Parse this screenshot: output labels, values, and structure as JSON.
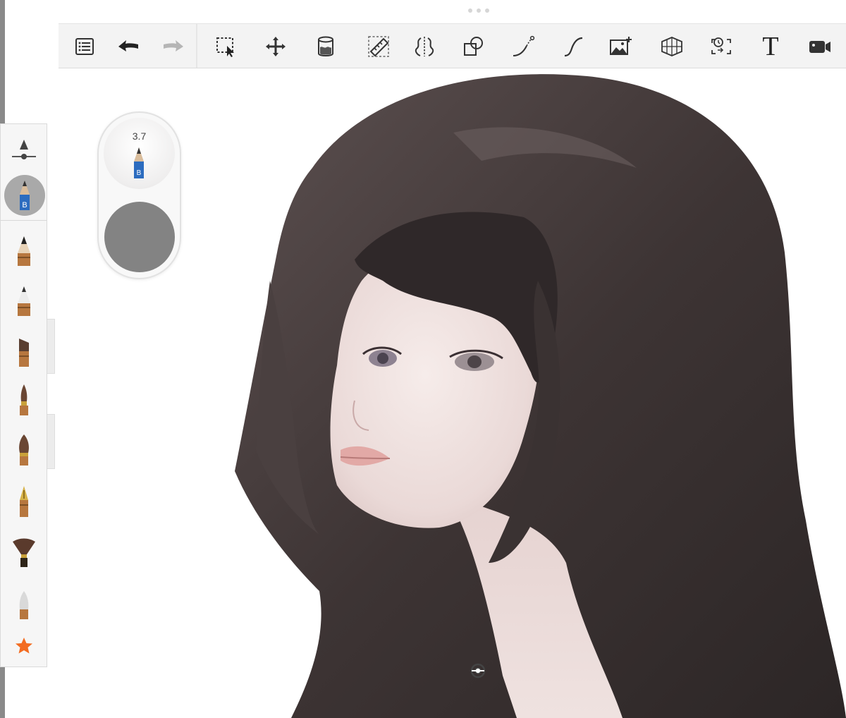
{
  "app": {
    "accent_color": "#f36c21",
    "current_color": "#838383"
  },
  "toolbar": {
    "items": [
      {
        "name": "menu",
        "icon": "list-menu-icon"
      },
      {
        "name": "undo",
        "icon": "undo-arrow-icon"
      },
      {
        "name": "redo",
        "icon": "redo-arrow-icon",
        "state": "disabled"
      },
      {
        "name": "selection",
        "icon": "selection-icon"
      },
      {
        "name": "transform",
        "icon": "move-arrows-icon"
      },
      {
        "name": "fill",
        "icon": "paint-bucket-icon"
      },
      {
        "name": "ruler",
        "icon": "ruler-icon"
      },
      {
        "name": "symmetry",
        "icon": "symmetry-icon"
      },
      {
        "name": "shape",
        "icon": "shapes-icon"
      },
      {
        "name": "predictive-stroke",
        "icon": "curve-stroke-icon"
      },
      {
        "name": "steady-stroke",
        "icon": "s-curve-icon"
      },
      {
        "name": "add-image",
        "icon": "image-add-icon"
      },
      {
        "name": "perspective-guide",
        "icon": "perspective-grid-icon"
      },
      {
        "name": "time-lapse",
        "icon": "timelapse-icon"
      },
      {
        "name": "text",
        "icon": "text-icon",
        "label": "T"
      },
      {
        "name": "record",
        "icon": "video-camera-icon"
      }
    ]
  },
  "brush_puck": {
    "size": "3.7",
    "pencil_letter": "B",
    "color": "#838383"
  },
  "brush_rail": {
    "active_brush": {
      "name": "pencil",
      "icon": "pencil-b-icon",
      "letter": "B"
    },
    "brushes": [
      {
        "name": "mechanical-pencil",
        "icon": "mechanical-pencil-icon"
      },
      {
        "name": "ballpoint-pen",
        "icon": "ballpoint-pen-icon"
      },
      {
        "name": "marker",
        "icon": "chisel-marker-icon"
      },
      {
        "name": "paint-brush",
        "icon": "paint-brush-icon"
      },
      {
        "name": "airbrush",
        "icon": "round-brush-icon"
      },
      {
        "name": "fountain-pen",
        "icon": "fountain-pen-icon"
      },
      {
        "name": "fan-brush",
        "icon": "fan-brush-icon"
      },
      {
        "name": "eraser",
        "icon": "eraser-icon"
      },
      {
        "name": "favorites",
        "icon": "star-icon"
      }
    ]
  },
  "canvas": {
    "subject": "portrait-artwork"
  }
}
